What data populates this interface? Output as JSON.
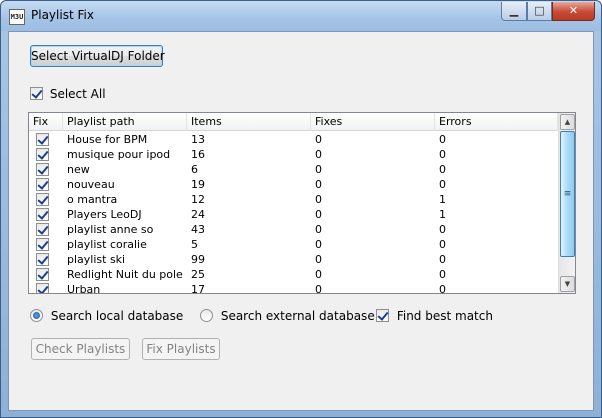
{
  "window": {
    "title": "Playlist Fix",
    "app_icon_text": "M3U"
  },
  "toolbar": {
    "select_folder_label": "Select VirtualDJ Folder"
  },
  "select_all": {
    "label": "Select All",
    "checked": true
  },
  "table": {
    "columns": [
      "Fix",
      "Playlist path",
      "Items",
      "Fixes",
      "Errors"
    ],
    "rows": [
      {
        "fix": true,
        "path": "House for BPM",
        "items": "13",
        "fixes": "0",
        "errors": "0"
      },
      {
        "fix": true,
        "path": "musique pour ipod",
        "items": "16",
        "fixes": "0",
        "errors": "0"
      },
      {
        "fix": true,
        "path": "new",
        "items": "6",
        "fixes": "0",
        "errors": "0"
      },
      {
        "fix": true,
        "path": "nouveau",
        "items": "19",
        "fixes": "0",
        "errors": "0"
      },
      {
        "fix": true,
        "path": "o mantra",
        "items": "12",
        "fixes": "0",
        "errors": "1"
      },
      {
        "fix": true,
        "path": "Players LeoDJ",
        "items": "24",
        "fixes": "0",
        "errors": "1"
      },
      {
        "fix": true,
        "path": "playlist anne so",
        "items": "43",
        "fixes": "0",
        "errors": "0"
      },
      {
        "fix": true,
        "path": "playlist coralie",
        "items": "5",
        "fixes": "0",
        "errors": "0"
      },
      {
        "fix": true,
        "path": "playlist ski",
        "items": "99",
        "fixes": "0",
        "errors": "0"
      },
      {
        "fix": true,
        "path": "Redlight Nuit du pole",
        "items": "25",
        "fixes": "0",
        "errors": "0"
      },
      {
        "fix": true,
        "path": "Urban",
        "items": "17",
        "fixes": "0",
        "errors": "0"
      }
    ]
  },
  "options": {
    "search_local_label": "Search local database",
    "search_external_label": "Search external database",
    "find_best_match_label": "Find best match",
    "selected_source": "local",
    "find_best_match": true
  },
  "actions": {
    "check_label": "Check Playlists",
    "fix_label": "Fix Playlists"
  },
  "colors": {
    "titlebar": "#a5c3e6",
    "close_button": "#c64a35",
    "client_bg": "#f0f0f0",
    "scroll_thumb": "#a9dbf6"
  }
}
